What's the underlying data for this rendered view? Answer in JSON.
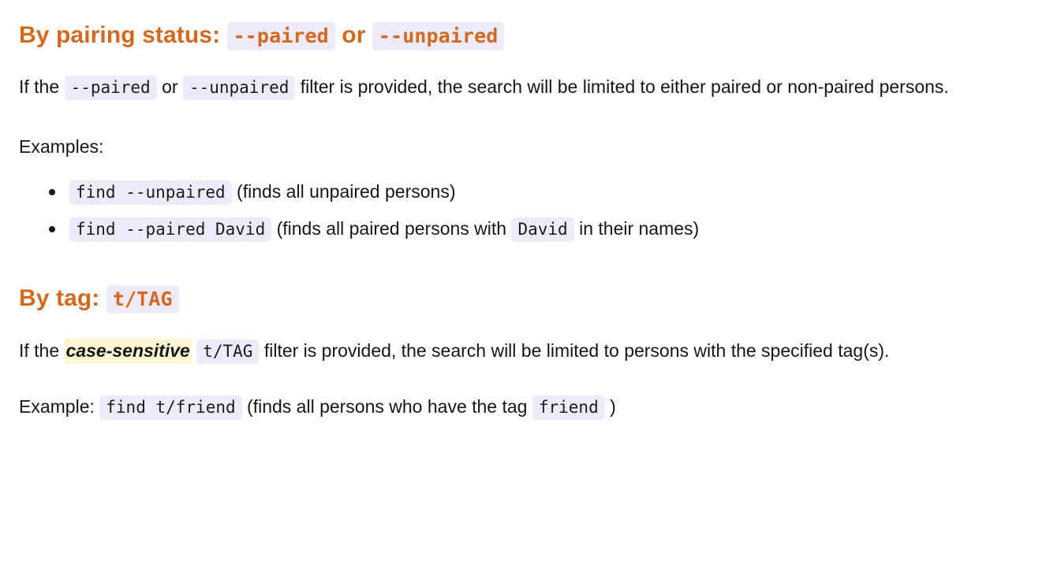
{
  "theme": {
    "page_background": "#ffffff",
    "heading_color": "#d2691e",
    "body_text_color": "#16161a",
    "code_background": "#eeeafa",
    "code_text_color": "#1b1b1d",
    "highlight_background": "#fdf6d3"
  },
  "sections": [
    {
      "heading": {
        "prefix": "By pairing status:",
        "code_1": "--paired",
        "conjunction": "or",
        "code_2": "--unpaired"
      },
      "paragraph": {
        "t1": "If the",
        "c1": "--paired",
        "t2": "or",
        "c2": "--unpaired",
        "t3": "filter is provided, the search will be limited to either paired or non-paired persons."
      },
      "examples_label": "Examples:",
      "examples": [
        {
          "code": "find --unpaired",
          "description": "(finds all unpaired persons)"
        },
        {
          "code": "find --paired David",
          "description_before": "(finds all paired persons with",
          "inline_code": "David",
          "description_after": "in their names)"
        }
      ]
    },
    {
      "heading": {
        "prefix": "By tag:",
        "code_1": "t/TAG"
      },
      "paragraph": {
        "t1": "If the",
        "highlight": "case-sensitive",
        "c1": "t/TAG",
        "t2": "filter is provided, the search will be limited to persons with the specified tag(s)."
      },
      "example_line": {
        "label": "Example:",
        "code": "find t/friend",
        "text_before": "(finds all persons who have the tag",
        "inline_code": "friend",
        "text_after": ")"
      }
    }
  ]
}
